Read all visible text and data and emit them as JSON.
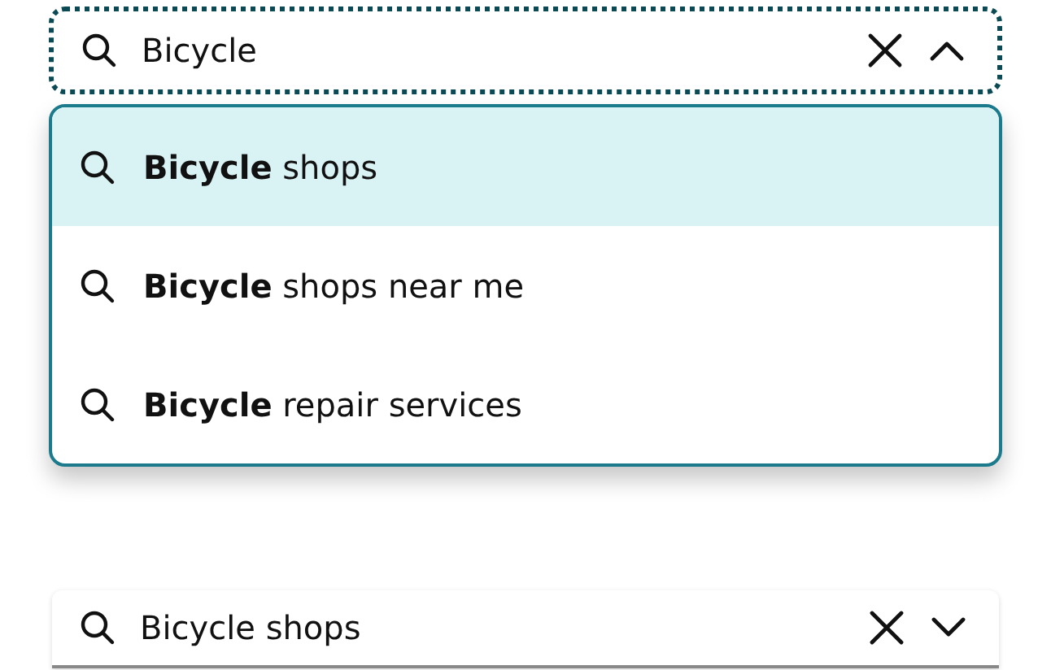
{
  "search": {
    "value": "Bicycle",
    "focused": true,
    "expanded": true
  },
  "suggestions": [
    {
      "text": "**Bicycle** shops",
      "selected": true
    },
    {
      "text": "**Bicycle** shops near me",
      "selected": false
    },
    {
      "text": "**Bicycle** repair services",
      "selected": false
    }
  ],
  "second_search": {
    "value": "Bicycle shops",
    "focused": false,
    "expanded": false
  }
}
